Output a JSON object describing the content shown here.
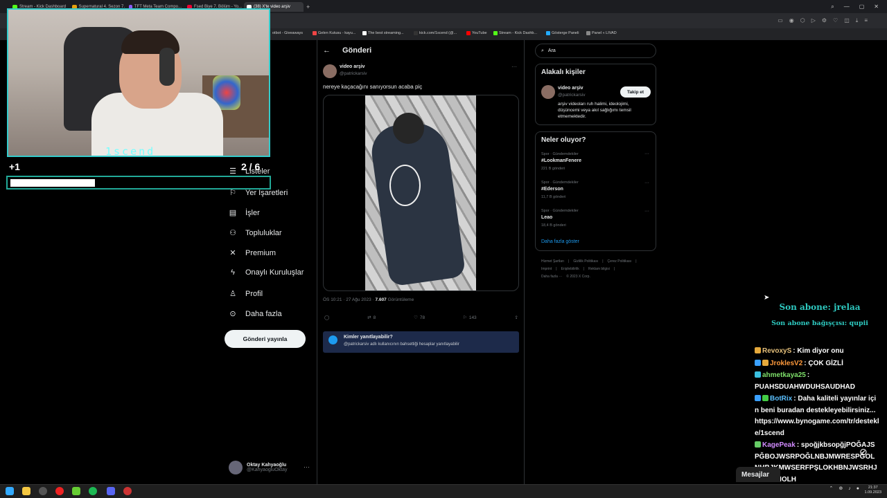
{
  "browser": {
    "tabs": [
      {
        "label": "Stream - Kick Dashboard",
        "color": "#53fc18"
      },
      {
        "label": "Supernatural 4. Sezon 7.",
        "color": "#e5a00d"
      },
      {
        "label": "TFT Meta Team Compo...",
        "color": "#8a5cf5"
      },
      {
        "label": "Fsed Biye 7. Bölüm - Yo...",
        "color": "#e03"
      },
      {
        "label": "(38) X'te video arşiv",
        "color": "#fff"
      }
    ],
    "bookmarks": [
      {
        "label": "otbot - Giveaways",
        "color": "#4a8"
      },
      {
        "label": "Gelen Kutusu - kayu...",
        "color": "#e44"
      },
      {
        "label": "The best streaming...",
        "color": "#fff"
      },
      {
        "label": "kick.com/1scend (@...",
        "color": "#111"
      },
      {
        "label": "YouTube",
        "color": "#f00"
      },
      {
        "label": "Stream - Kick Dashb...",
        "color": "#53fc18"
      },
      {
        "label": "Gösterge Paneli",
        "color": "#2af"
      },
      {
        "label": "Panel « LIVAD",
        "color": "#888"
      }
    ]
  },
  "overlay": {
    "cam_label": "1scend",
    "goal_left": "+1",
    "goal_right": "2 / 6",
    "goal_progress": 0.33
  },
  "nav": {
    "items": [
      {
        "label": "Listeler",
        "icon": "list-icon",
        "glyph": "☰"
      },
      {
        "label": "Yer İşaretleri",
        "icon": "bookmark-icon",
        "glyph": "🔖"
      },
      {
        "label": "İşler",
        "icon": "briefcase-icon",
        "glyph": "💼"
      },
      {
        "label": "Topluluklar",
        "icon": "communities-icon",
        "glyph": "👥"
      },
      {
        "label": "Premium",
        "icon": "x-logo-icon",
        "glyph": "𝕏"
      },
      {
        "label": "Onaylı Kuruluşlar",
        "icon": "lightning-icon",
        "glyph": "⚡"
      },
      {
        "label": "Profil",
        "icon": "person-icon",
        "glyph": "👤"
      },
      {
        "label": "Daha fazla",
        "icon": "more-circle-icon",
        "glyph": "⊙"
      }
    ],
    "post_button": "Gönderi yayınla",
    "profile_name": "Oktay Kahyaoğlu",
    "profile_handle": "@KahyaogluOktay"
  },
  "main": {
    "title": "Gönderi",
    "author_name": "video arşiv",
    "author_handle": "@patrickarsiv",
    "text": "nereye kaçacağını sanıyorsun acaba piç",
    "time": "ÖS 10:21 · 27 Ağu 2023 · ",
    "views_count": "7.607",
    "views_label": " Görüntüleme",
    "reposts": "8",
    "likes": "78",
    "bookmarks": "143",
    "reply_title": "Kimler yanıtlayabilir?",
    "reply_sub": "@patrickarsiv adlı kullanıcının bahsettiği hesaplar yanıtlayabilir"
  },
  "right": {
    "search_placeholder": "Ara",
    "related_title": "Alakalı kişiler",
    "related_name": "video arşiv",
    "related_handle": "@patrickarsiv",
    "related_bio": "arşiv videoları ruh halimi, ideolojimi, düşüncemi veya akıl sağlığımı temsil etmemektedir.",
    "follow": "Takip et",
    "trends_title": "Neler oluyor?",
    "trends": [
      {
        "category": "Spor · Gündemdekiler",
        "name": "#LookmanFenere",
        "count": "221 B gönderi"
      },
      {
        "category": "Spor · Gündemdekiler",
        "name": "#Ederson",
        "count": "11,7 B gönderi"
      },
      {
        "category": "Spor · Gündemdekiler",
        "name": "Leao",
        "count": "18,4 B gönderi"
      }
    ],
    "show_more": "Daha fazla göster",
    "footer": [
      "Hizmet Şartları",
      "|",
      "Gizlilik Politikası",
      "|",
      "Çerez Politikası",
      "|",
      "Imprint",
      "|",
      "Erişilebilirlik",
      "|",
      "Reklam bilgisi",
      "|",
      "Daha fazla ···",
      "© 2023 X Corp."
    ]
  },
  "chat": {
    "last_sub": "Son abone: jrelaa",
    "last_gift": "Son abone bağışçısı: qupii",
    "messages": [
      {
        "name": "RevoxyS",
        "color": "#e5c07b",
        "text": ": Kim diyor onu"
      },
      {
        "name": "JroklesV2",
        "color": "#ff9a3c",
        "text": ": ÇOK GİZLİ"
      },
      {
        "name": "ahmetkaya25",
        "color": "#7ee06a",
        "text": ": PUAHSDUAHWDUHSAUDHAD"
      },
      {
        "name": "BotRix",
        "color": "#5bc0ff",
        "text": ": Daha kaliteli yayınlar için beni buradan destekleyebilirsiniz...https://www.bynogame.com/tr/destekle/1scend"
      },
      {
        "name": "KagePeak",
        "color": "#d28cff",
        "text": ": spoğjkbsopğjPOĞAJSPĞBOJWSRPOĞLNBJMWRESPĞOLNHBJKMWSERFPŞLOKHBNJWSRHJKWRSMOLH"
      }
    ],
    "messages_tab": "Mesajlar"
  },
  "system": {
    "time": "21:37",
    "date": "1.09.2023"
  }
}
